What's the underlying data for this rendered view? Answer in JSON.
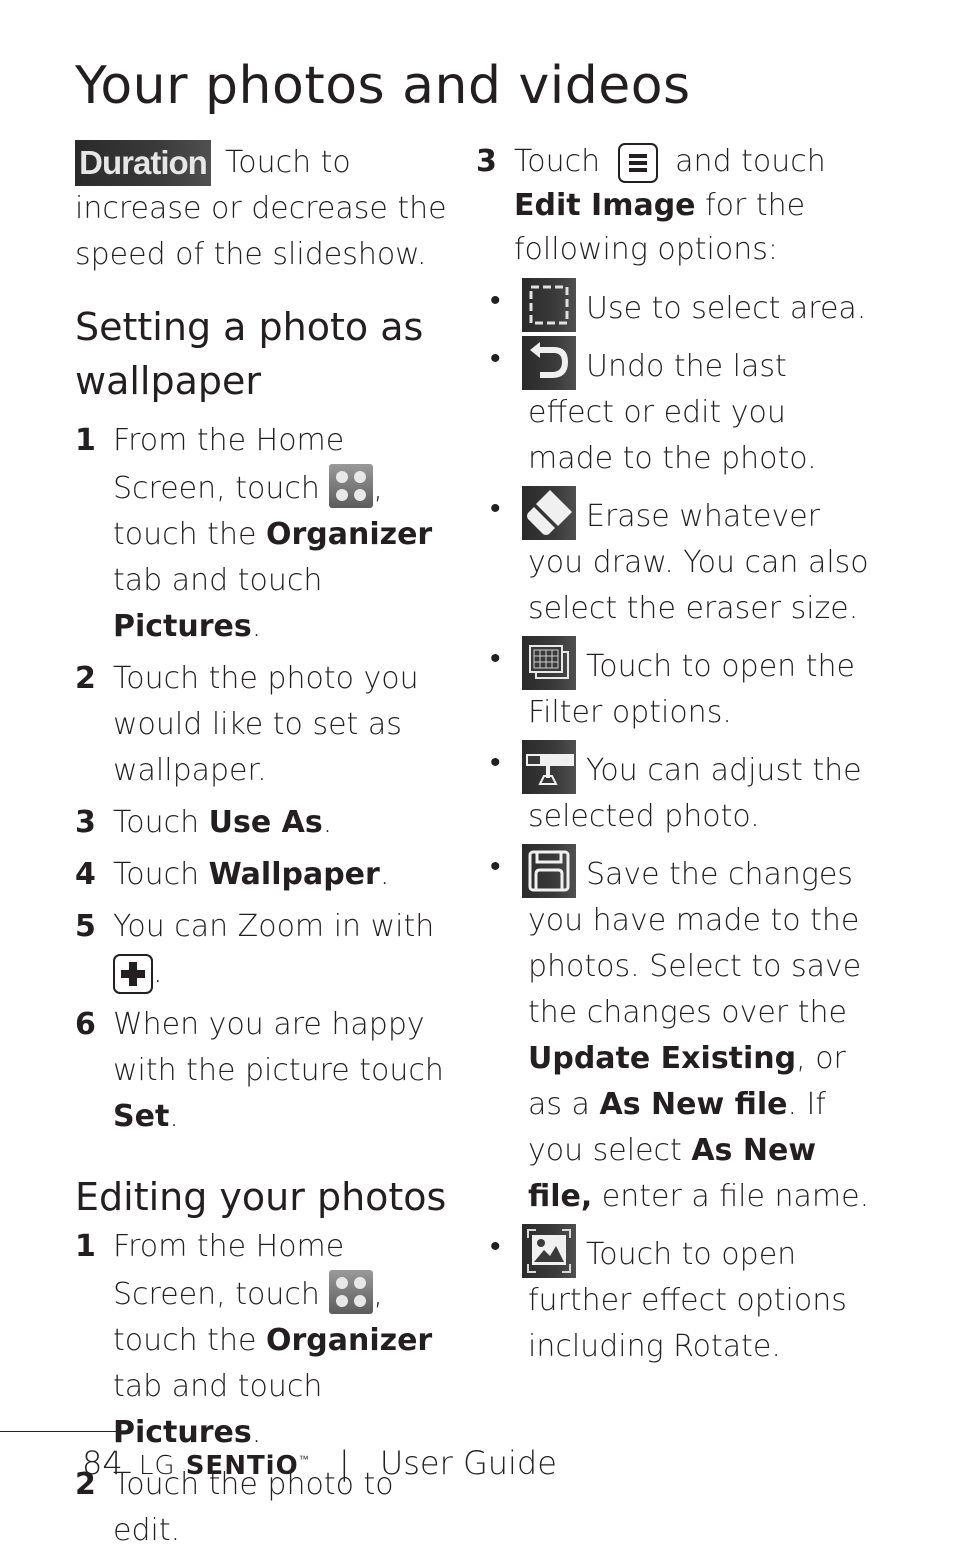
{
  "page": {
    "title": "Your photos and videos"
  },
  "intro": {
    "duration_icon_label": "Duration",
    "text": "Touch to increase or decrease the speed of the slideshow."
  },
  "wallpaper_section": {
    "heading": "Setting a photo as wallpaper",
    "steps": [
      {
        "num": "1",
        "pre": "From the Home Screen, touch ",
        "icon": "applications-grid-icon",
        "mid1": ", touch the ",
        "bold1": "Organizer",
        "mid2": " tab and touch ",
        "bold2": "Pictures",
        "end": "."
      },
      {
        "num": "2",
        "text": "Touch the photo you would like to set as wallpaper."
      },
      {
        "num": "3",
        "pre": "Touch ",
        "bold": "Use As",
        "end": "."
      },
      {
        "num": "4",
        "pre": "Touch ",
        "bold": "Wallpaper",
        "end": "."
      },
      {
        "num": "5",
        "pre": "You can Zoom in with ",
        "icon": "zoom-plus-icon",
        "end": "."
      },
      {
        "num": "6",
        "pre": "When you are happy with the picture touch ",
        "bold": "Set",
        "end": "."
      }
    ]
  },
  "editing_section": {
    "heading": "Editing your photos",
    "steps": [
      {
        "num": "1",
        "pre": "From the Home Screen, touch ",
        "icon": "applications-grid-icon",
        "mid1": ", touch the ",
        "bold1": "Organizer",
        "mid2": " tab and touch ",
        "bold2": "Pictures",
        "end": "."
      },
      {
        "num": "2",
        "text": "Touch the photo to edit."
      },
      {
        "num": "3",
        "pre": "Touch ",
        "icon": "menu-icon",
        "mid1": " and touch ",
        "bold1": "Edit Image",
        "end": " for the following options:"
      }
    ],
    "options": [
      {
        "icon": "select-area-icon",
        "text": "Use to select area."
      },
      {
        "icon": "undo-icon",
        "text": "Undo the last effect or edit you made to the photo."
      },
      {
        "icon": "eraser-icon",
        "text": "Erase whatever you draw. You can also select the eraser size."
      },
      {
        "icon": "filter-icon",
        "text": "Touch to open the Filter options."
      },
      {
        "icon": "adjust-icon",
        "text": "You can adjust the selected photo."
      },
      {
        "icon": "save-icon",
        "t1": "Save the changes you have made to the photos. Select to save the changes over the ",
        "b1": "Update Existing",
        "t2": ", or as a ",
        "b2": "As New file",
        "t3": ". If you select ",
        "b3": "As New file,",
        "t4": " enter a file name."
      },
      {
        "icon": "effects-icon",
        "text": "Touch to open further effect options including Rotate."
      }
    ]
  },
  "footer": {
    "page_number": "84",
    "brand": "LG",
    "model": "SENTiO",
    "trademark": "™",
    "separator": "|",
    "guide": "User Guide"
  }
}
